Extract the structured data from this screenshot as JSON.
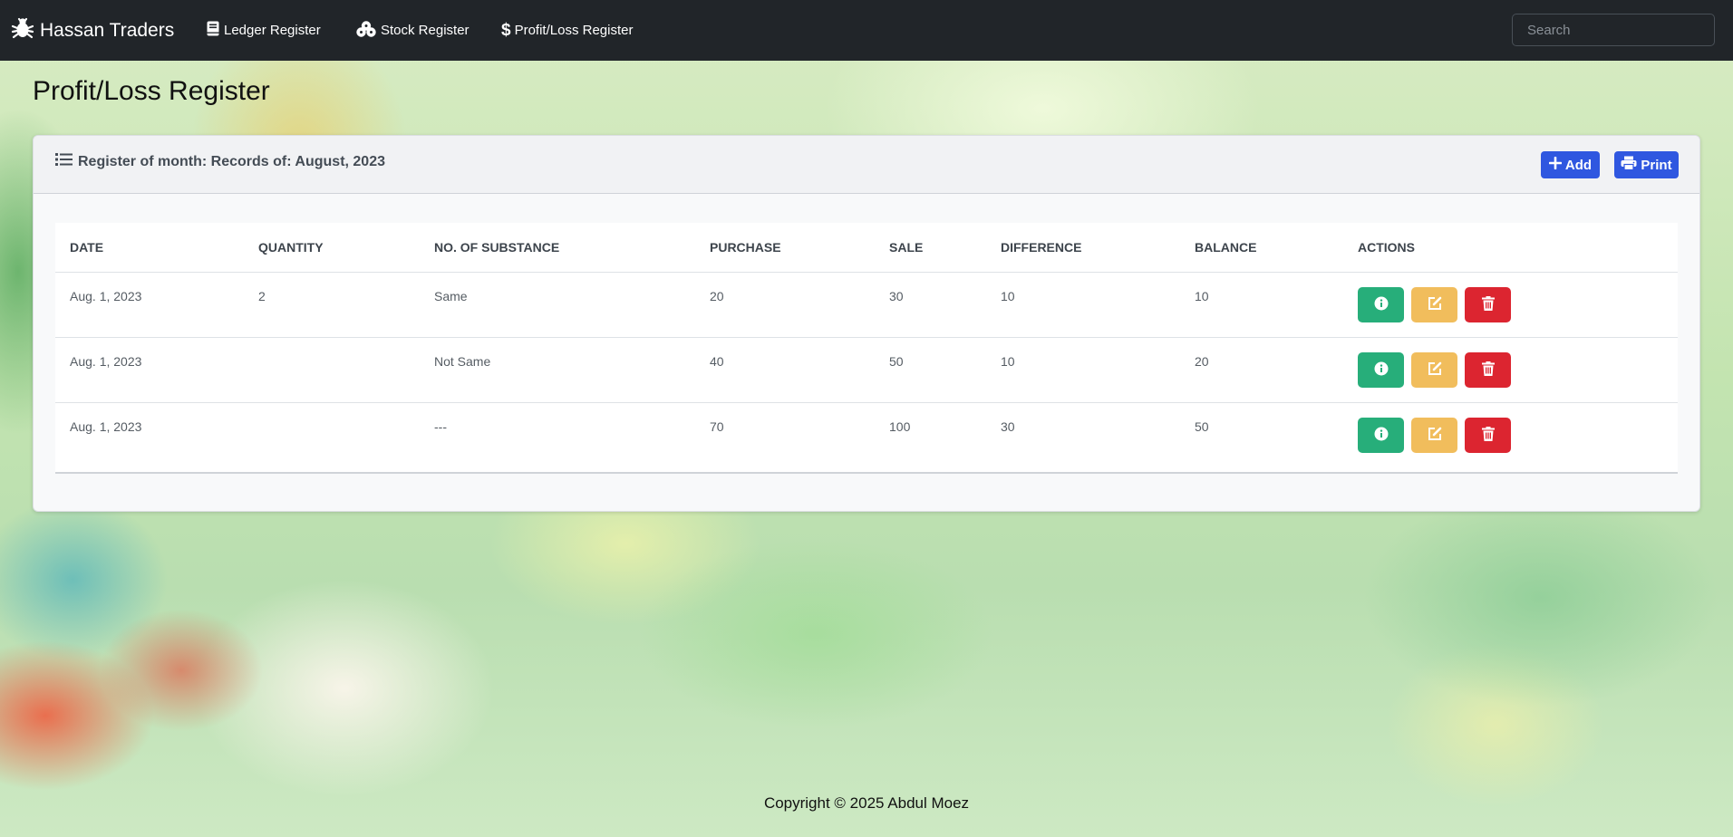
{
  "navbar": {
    "brand": "Hassan Traders",
    "brand_icon": "bug-icon",
    "links": [
      {
        "label": "Ledger Register",
        "icon": "book-icon"
      },
      {
        "label": "Stock Register",
        "icon": "boxes-icon"
      },
      {
        "label": "Profit/Loss Register",
        "icon": "dollar-icon"
      }
    ],
    "search_placeholder": "Search"
  },
  "page": {
    "title": "Profit/Loss Register"
  },
  "card": {
    "title": "Register of month: Records of: August, 2023",
    "title_icon": "list-icon",
    "add_label": "Add",
    "print_label": "Print"
  },
  "table": {
    "columns": [
      "DATE",
      "QUANTITY",
      "NO. OF SUBSTANCE",
      "PURCHASE",
      "SALE",
      "DIFFERENCE",
      "BALANCE",
      "ACTIONS"
    ],
    "rows": [
      {
        "date": "Aug. 1, 2023",
        "quantity": "2",
        "substance": "Same",
        "purchase": "20",
        "sale": "30",
        "difference": "10",
        "balance": "10"
      },
      {
        "date": "Aug. 1, 2023",
        "quantity": "",
        "substance": "Not Same",
        "purchase": "40",
        "sale": "50",
        "difference": "10",
        "balance": "20"
      },
      {
        "date": "Aug. 1, 2023",
        "quantity": "",
        "substance": "---",
        "purchase": "70",
        "sale": "100",
        "difference": "30",
        "balance": "50"
      }
    ],
    "action_icons": [
      "info-icon",
      "edit-icon",
      "trash-icon"
    ]
  },
  "colors": {
    "navbar": "#212529",
    "primary": "#2f57e0",
    "info": "#27ae7a",
    "edit": "#f1bd5c",
    "delete": "#dc2530"
  },
  "footer": {
    "text": "Copyright © 2025 Abdul Moez"
  }
}
